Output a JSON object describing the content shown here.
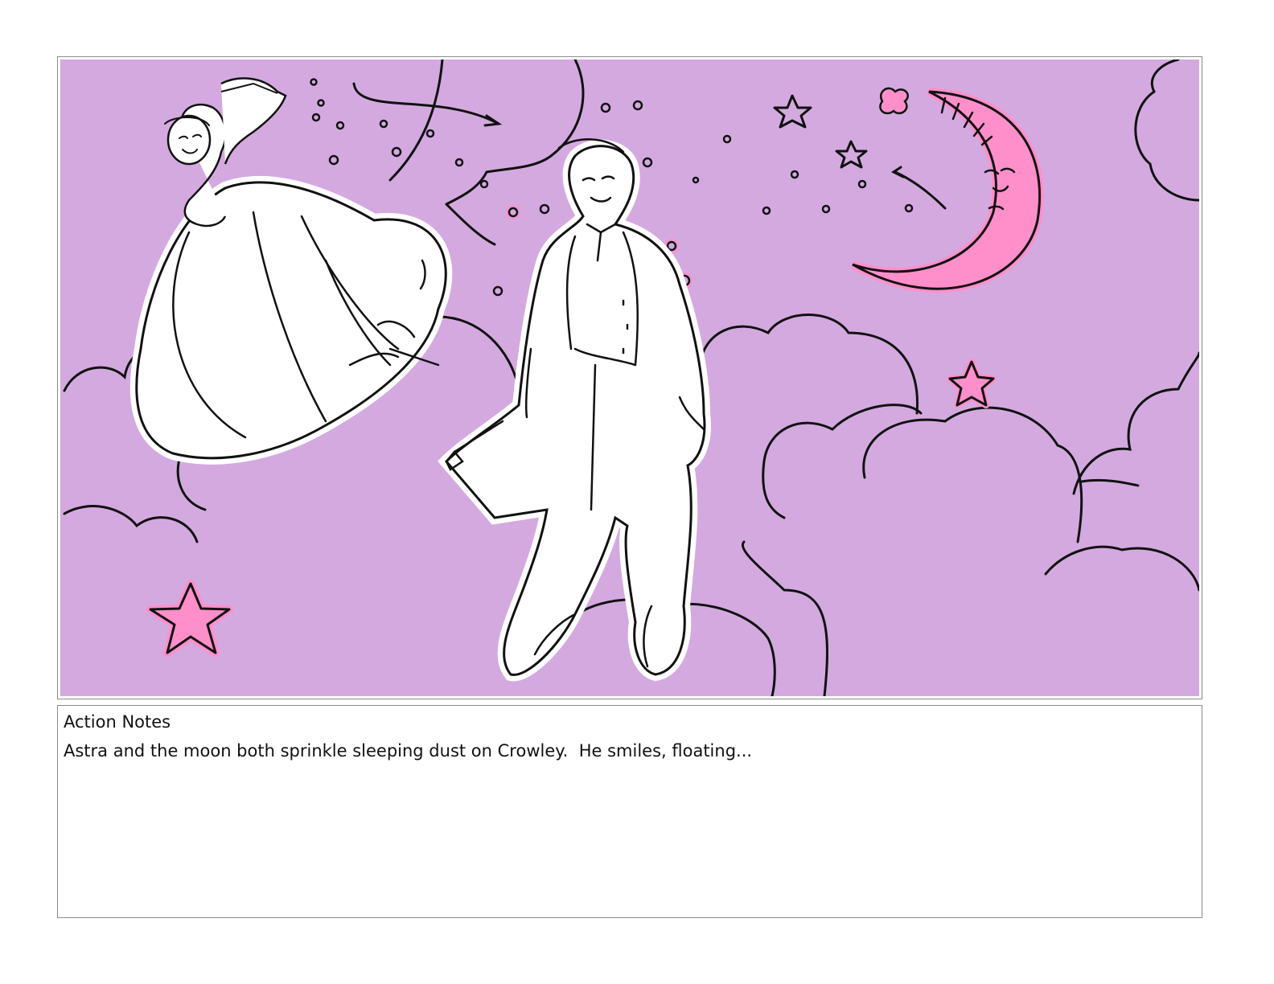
{
  "panel": {
    "background_color": "#d4a9e0",
    "accent_pink": "#ff8fcb",
    "line_color": "#111111"
  },
  "notes": {
    "label": "Action Notes",
    "text": "Astra and the moon both sprinkle sleeping dust on Crowley.  He smiles, floating..."
  }
}
